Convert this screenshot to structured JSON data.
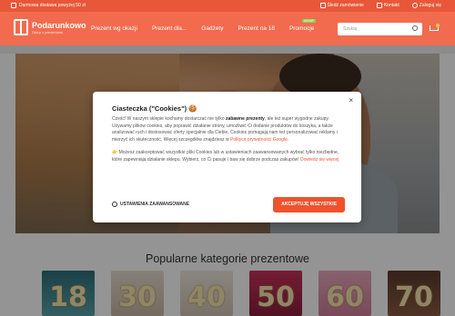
{
  "topbar": {
    "shipping": "Darmowa dostawa powyżej 50 zł",
    "links": [
      "Śledź zamówienie",
      "Kontakt",
      "Zaloguj się"
    ]
  },
  "header": {
    "logo_name": "Podarunkowo",
    "logo_tagline": "Sklep z prezentami",
    "nav": [
      "Prezent wg okazji",
      "Prezent dla...",
      "Gadżety",
      "Prezent na 18",
      "Promocje"
    ],
    "promo_badge": "NOWE",
    "search_placeholder": "Szukaj"
  },
  "categories": {
    "title": "Popularne kategorie prezentowe",
    "numbers": [
      "18",
      "30",
      "40",
      "50",
      "60",
      "70"
    ]
  },
  "cookie_modal": {
    "close": "×",
    "title": "Ciasteczka (\"Cookies\") 🍪",
    "p1_a": "Cześć! W naszym sklepie kochamy dostarczać nie tylko ",
    "p1_b": "zabawne prezenty",
    "p1_c": ", ale też super wygodne zakupy. Używamy plików cookies, aby poprawić działanie strony, umożliwić Ci dodanie produktów do koszyka, a także analizować ruch i dostosować oferty specjalnie dla Ciebie. Cookies pomagają nam też personalizować reklamy i mierzyć ich skuteczność. Więcej szczegółów znajdziesz w ",
    "p1_link": "Polityce prywatności Google",
    "p1_d": ".",
    "p2_a": "👉 Możesz zaakceptować wszystkie pliki Cookies lub w ustawieniach zaawansowanych wybrać tylko niezbędne, które zapewniają działanie sklepu. Wybierz, co Ci pasuje i baw się dobrze podczas zakupów! ",
    "p2_link": "Dowiedz się więcej",
    "settings_label": "USTAWIENIA ZAAWANSOWANE",
    "accept_label": "AKCEPTUJĘ WSZYSTKIE"
  }
}
